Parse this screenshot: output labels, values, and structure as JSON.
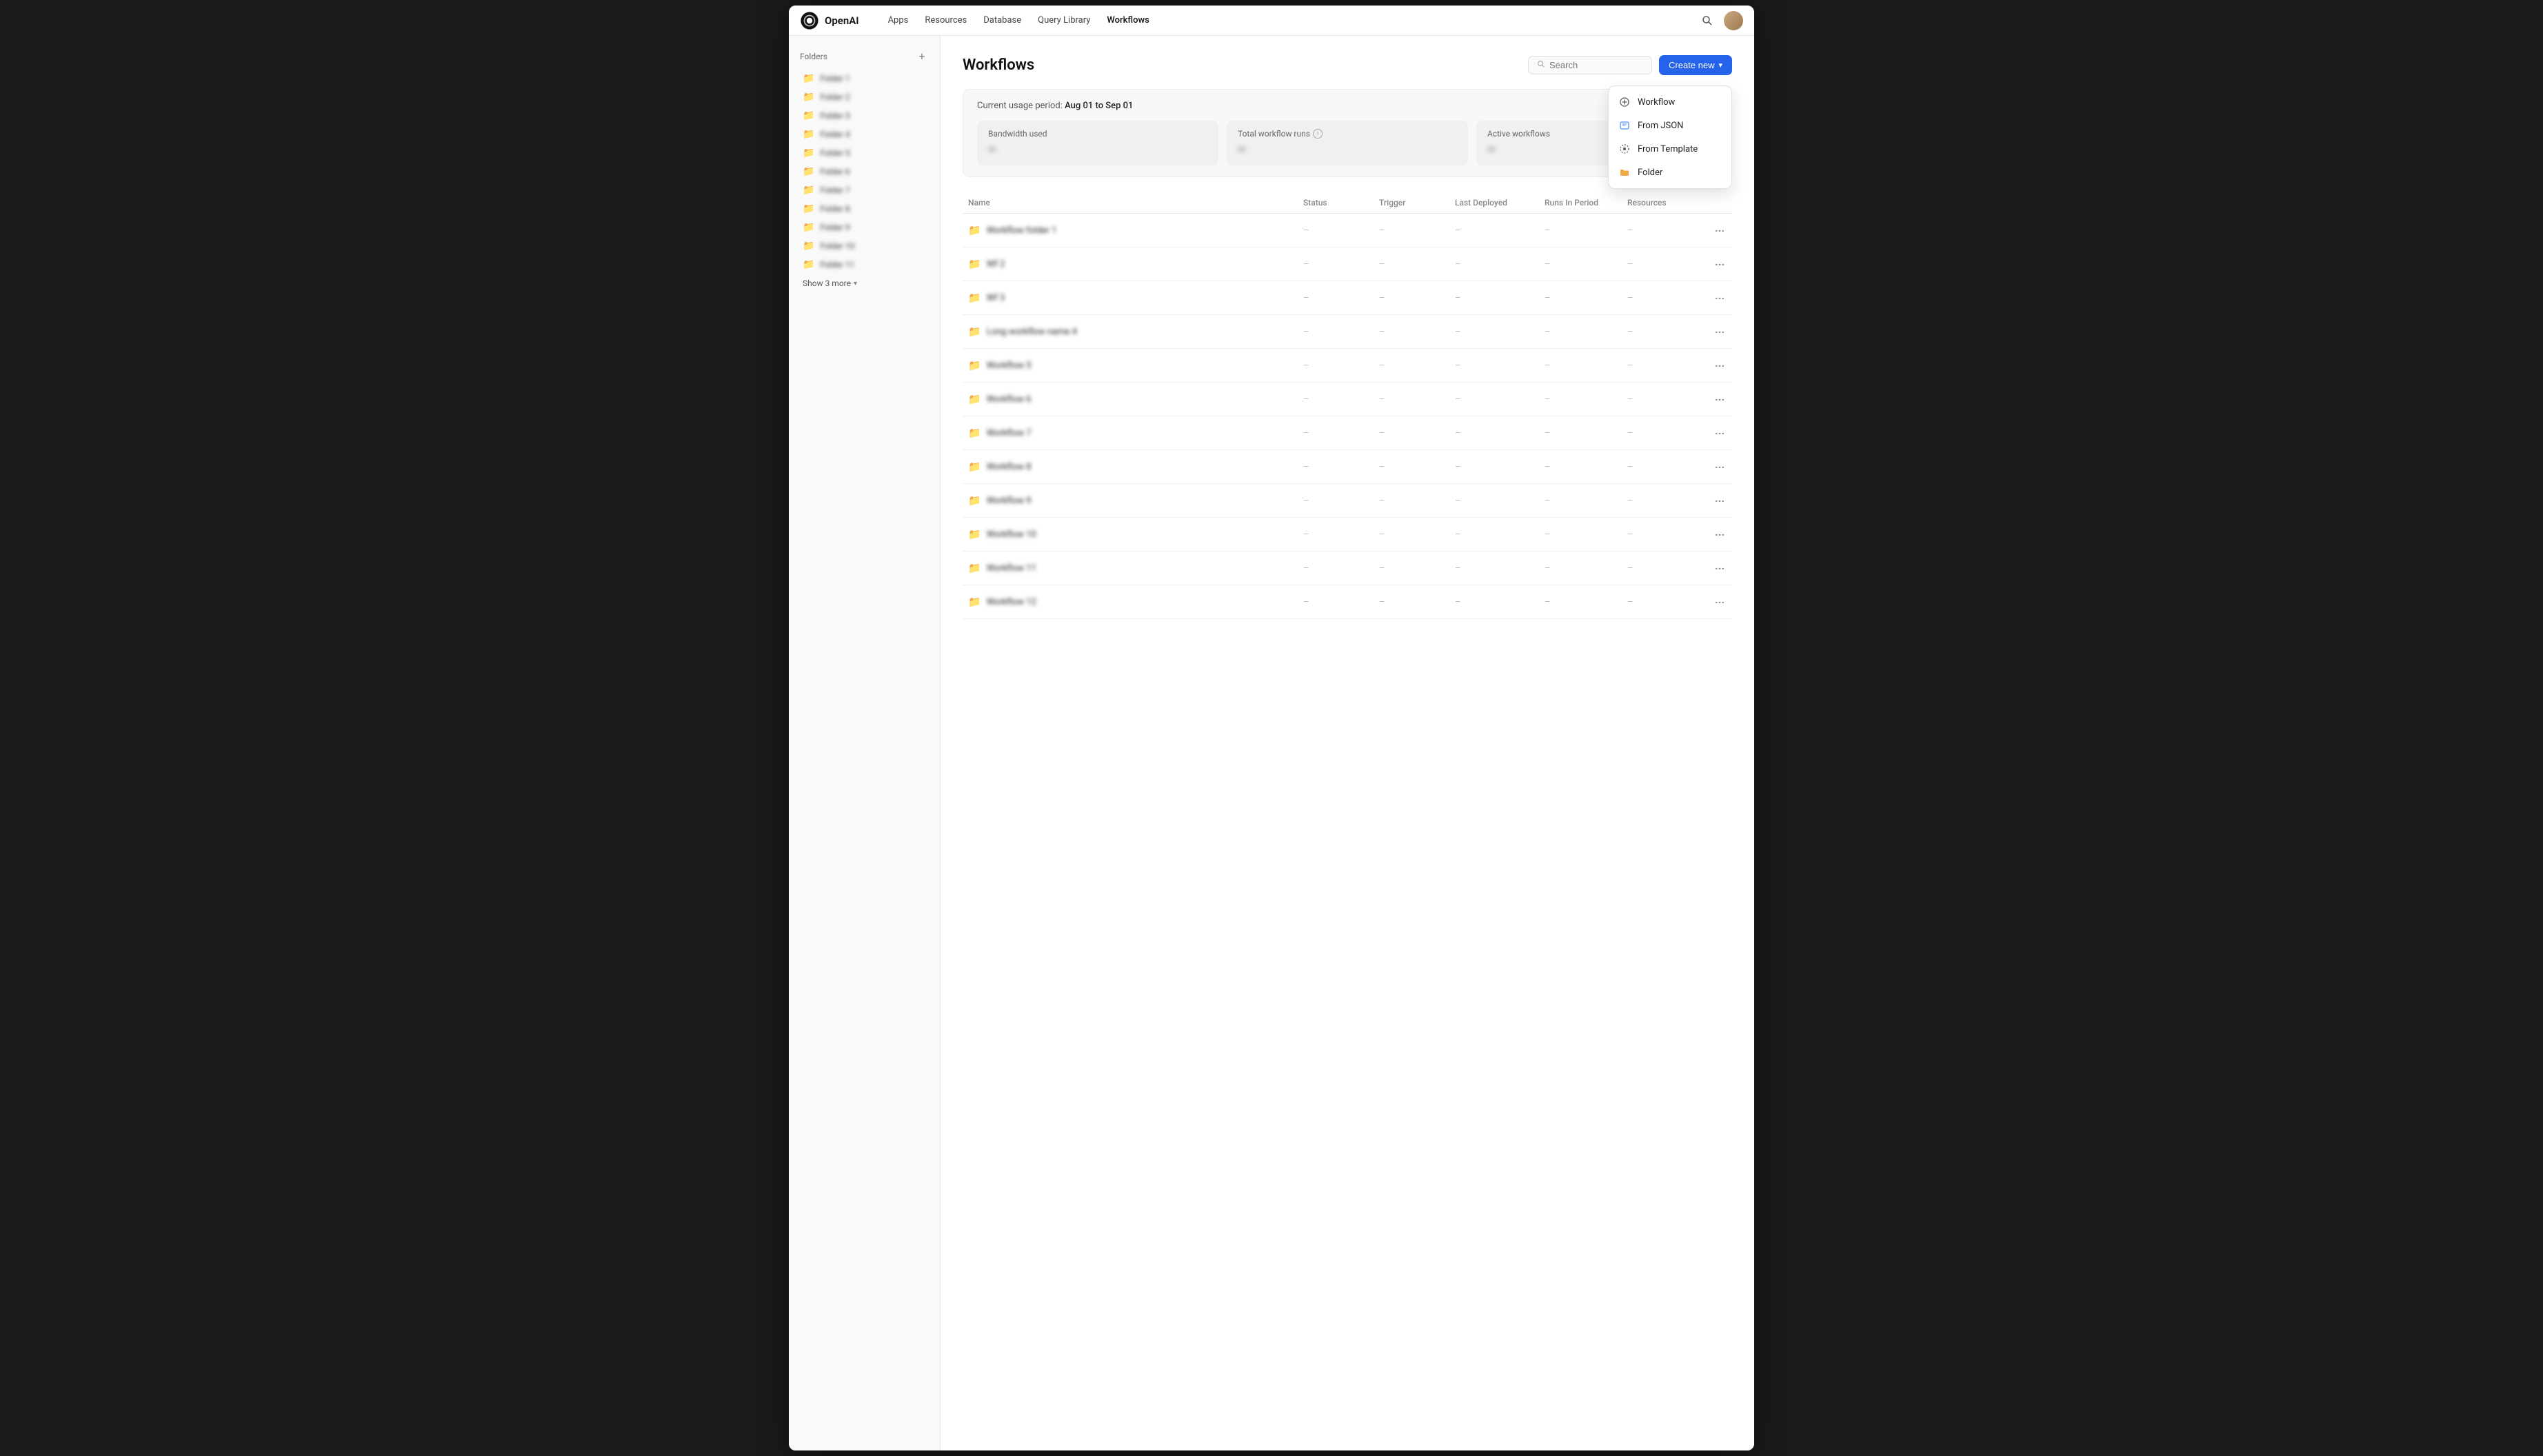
{
  "app": {
    "logo": "OpenAI",
    "nav": {
      "links": [
        {
          "label": "Apps",
          "active": false
        },
        {
          "label": "Resources",
          "active": false
        },
        {
          "label": "Database",
          "active": false
        },
        {
          "label": "Query Library",
          "active": false
        },
        {
          "label": "Workflows",
          "active": true
        }
      ]
    }
  },
  "sidebar": {
    "section_title": "Folders",
    "add_label": "+",
    "items": [
      {
        "name": "Folder 1"
      },
      {
        "name": "Folder 2"
      },
      {
        "name": "Folder 3"
      },
      {
        "name": "Folder 4"
      },
      {
        "name": "Folder 5"
      },
      {
        "name": "Folder 6"
      },
      {
        "name": "Folder 7"
      },
      {
        "name": "Folder 8"
      },
      {
        "name": "Folder 9"
      },
      {
        "name": "Folder 10"
      },
      {
        "name": "Folder 11"
      }
    ],
    "show_more_label": "Show 3 more"
  },
  "page": {
    "title": "Workflows",
    "search_placeholder": "Search",
    "create_btn_label": "Create new"
  },
  "usage": {
    "period_label": "Current usage period:",
    "period_value": "Aug 01 to Sep 01",
    "stats": [
      {
        "label": "Bandwidth used",
        "value": "–",
        "has_info": false
      },
      {
        "label": "Total workflow runs",
        "value": "–",
        "has_info": true
      },
      {
        "label": "Active workflows",
        "value": "–",
        "has_info": false
      }
    ]
  },
  "dropdown": {
    "items": [
      {
        "label": "Workflow",
        "icon": "plus"
      },
      {
        "label": "From JSON",
        "icon": "json"
      },
      {
        "label": "From Template",
        "icon": "template"
      },
      {
        "label": "Folder",
        "icon": "folder"
      }
    ]
  },
  "table": {
    "columns": [
      "Name",
      "Status",
      "Trigger",
      "Last Deployed",
      "Runs In Period",
      "Resources"
    ],
    "rows": [
      {
        "name": "Workflow folder 1"
      },
      {
        "name": "Wf 2"
      },
      {
        "name": "Wf 3"
      },
      {
        "name": "Long workflow name 4"
      },
      {
        "name": "Workflow 5"
      },
      {
        "name": "Workflow 6"
      },
      {
        "name": "Workflow 7"
      },
      {
        "name": "Workflow 8"
      },
      {
        "name": "Workflow 9"
      },
      {
        "name": "Workflow 10"
      },
      {
        "name": "Workflow 11"
      },
      {
        "name": "Workflow 12"
      }
    ]
  }
}
